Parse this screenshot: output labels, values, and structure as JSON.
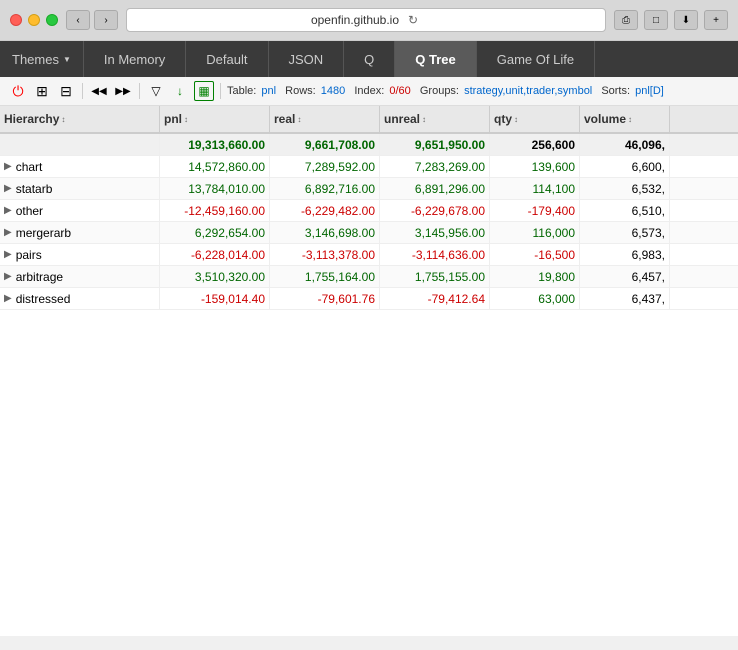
{
  "browser": {
    "url": "openfin.github.io",
    "back_label": "‹",
    "forward_label": "›",
    "reload_label": "↻"
  },
  "tabs": [
    {
      "id": "themes",
      "label": "Themes",
      "active": false,
      "is_dropdown": true
    },
    {
      "id": "in-memory",
      "label": "In Memory",
      "active": false
    },
    {
      "id": "default",
      "label": "Default",
      "active": false
    },
    {
      "id": "json",
      "label": "JSON",
      "active": false
    },
    {
      "id": "q",
      "label": "Q",
      "active": false
    },
    {
      "id": "q-tree",
      "label": "Q Tree",
      "active": true
    },
    {
      "id": "game-of-life",
      "label": "Game Of Life",
      "active": false
    }
  ],
  "toolbar": {
    "table_label": "Table:",
    "table_value": "pnl",
    "rows_label": "Rows:",
    "rows_value": "1480",
    "index_label": "Index:",
    "index_value": "0/60",
    "groups_label": "Groups:",
    "groups_value": "strategy,unit,trader,symbol",
    "sorts_label": "Sorts:",
    "sorts_value": "pnl[D]"
  },
  "table": {
    "columns": [
      {
        "id": "hierarchy",
        "label": "Hierarchy",
        "sortable": true
      },
      {
        "id": "pnl",
        "label": "pnl",
        "sortable": true,
        "sort": "↕"
      },
      {
        "id": "real",
        "label": "real",
        "sortable": true
      },
      {
        "id": "unreal",
        "label": "unreal",
        "sortable": true
      },
      {
        "id": "qty",
        "label": "qty",
        "sortable": true
      },
      {
        "id": "volume",
        "label": "volume",
        "sortable": true
      }
    ],
    "summary_row": {
      "hierarchy": "",
      "pnl": "19,313,660.00",
      "pnl_class": "green-text",
      "real": "9,661,708.00",
      "real_class": "green-text",
      "unreal": "9,651,950.00",
      "unreal_class": "green-text",
      "qty": "256,600",
      "qty_class": "",
      "volume": "46,096,"
    },
    "rows": [
      {
        "name": "chart",
        "expandable": true,
        "pnl": "14,572,860.00",
        "pnl_class": "green-text",
        "real": "7,289,592.00",
        "real_class": "green-text",
        "unreal": "7,283,269.00",
        "unreal_class": "green-text",
        "qty": "139,600",
        "qty_class": "green-text",
        "volume": "6,600,"
      },
      {
        "name": "statarb",
        "expandable": true,
        "pnl": "13,784,010.00",
        "pnl_class": "green-text",
        "real": "6,892,716.00",
        "real_class": "green-text",
        "unreal": "6,891,296.00",
        "unreal_class": "green-text",
        "qty": "114,100",
        "qty_class": "green-text",
        "volume": "6,532,"
      },
      {
        "name": "other",
        "expandable": true,
        "pnl": "-12,459,160.00",
        "pnl_class": "red-text",
        "real": "-6,229,482.00",
        "real_class": "red-text",
        "unreal": "-6,229,678.00",
        "unreal_class": "red-text",
        "qty": "-179,400",
        "qty_class": "red-text",
        "volume": "6,510,"
      },
      {
        "name": "mergerarb",
        "expandable": true,
        "pnl": "6,292,654.00",
        "pnl_class": "green-text",
        "real": "3,146,698.00",
        "real_class": "green-text",
        "unreal": "3,145,956.00",
        "unreal_class": "green-text",
        "qty": "116,000",
        "qty_class": "green-text",
        "volume": "6,573,"
      },
      {
        "name": "pairs",
        "expandable": true,
        "pnl": "-6,228,014.00",
        "pnl_class": "red-text",
        "real": "-3,113,378.00",
        "real_class": "red-text",
        "unreal": "-3,114,636.00",
        "unreal_class": "red-text",
        "qty": "-16,500",
        "qty_class": "red-text",
        "volume": "6,983,"
      },
      {
        "name": "arbitrage",
        "expandable": true,
        "pnl": "3,510,320.00",
        "pnl_class": "green-text",
        "real": "1,755,164.00",
        "real_class": "green-text",
        "unreal": "1,755,155.00",
        "unreal_class": "green-text",
        "qty": "19,800",
        "qty_class": "green-text",
        "volume": "6,457,"
      },
      {
        "name": "distressed",
        "expandable": true,
        "pnl": "-159,014.40",
        "pnl_class": "red-text",
        "real": "-79,601.76",
        "real_class": "red-text",
        "unreal": "-79,412.64",
        "unreal_class": "red-text",
        "qty": "63,000",
        "qty_class": "green-text",
        "volume": "6,437,"
      }
    ]
  },
  "icons": {
    "power": "⏻",
    "grid1": "⊞",
    "grid2": "⊟",
    "prev": "◀",
    "next": "▶",
    "filter": "▽",
    "down_arrow": "↓",
    "table_icon": "▦",
    "expand": "▶",
    "collapse": "▼",
    "sort_asc": "▲",
    "sort_desc": "▼",
    "sort_both": "↕",
    "dots": "···"
  }
}
